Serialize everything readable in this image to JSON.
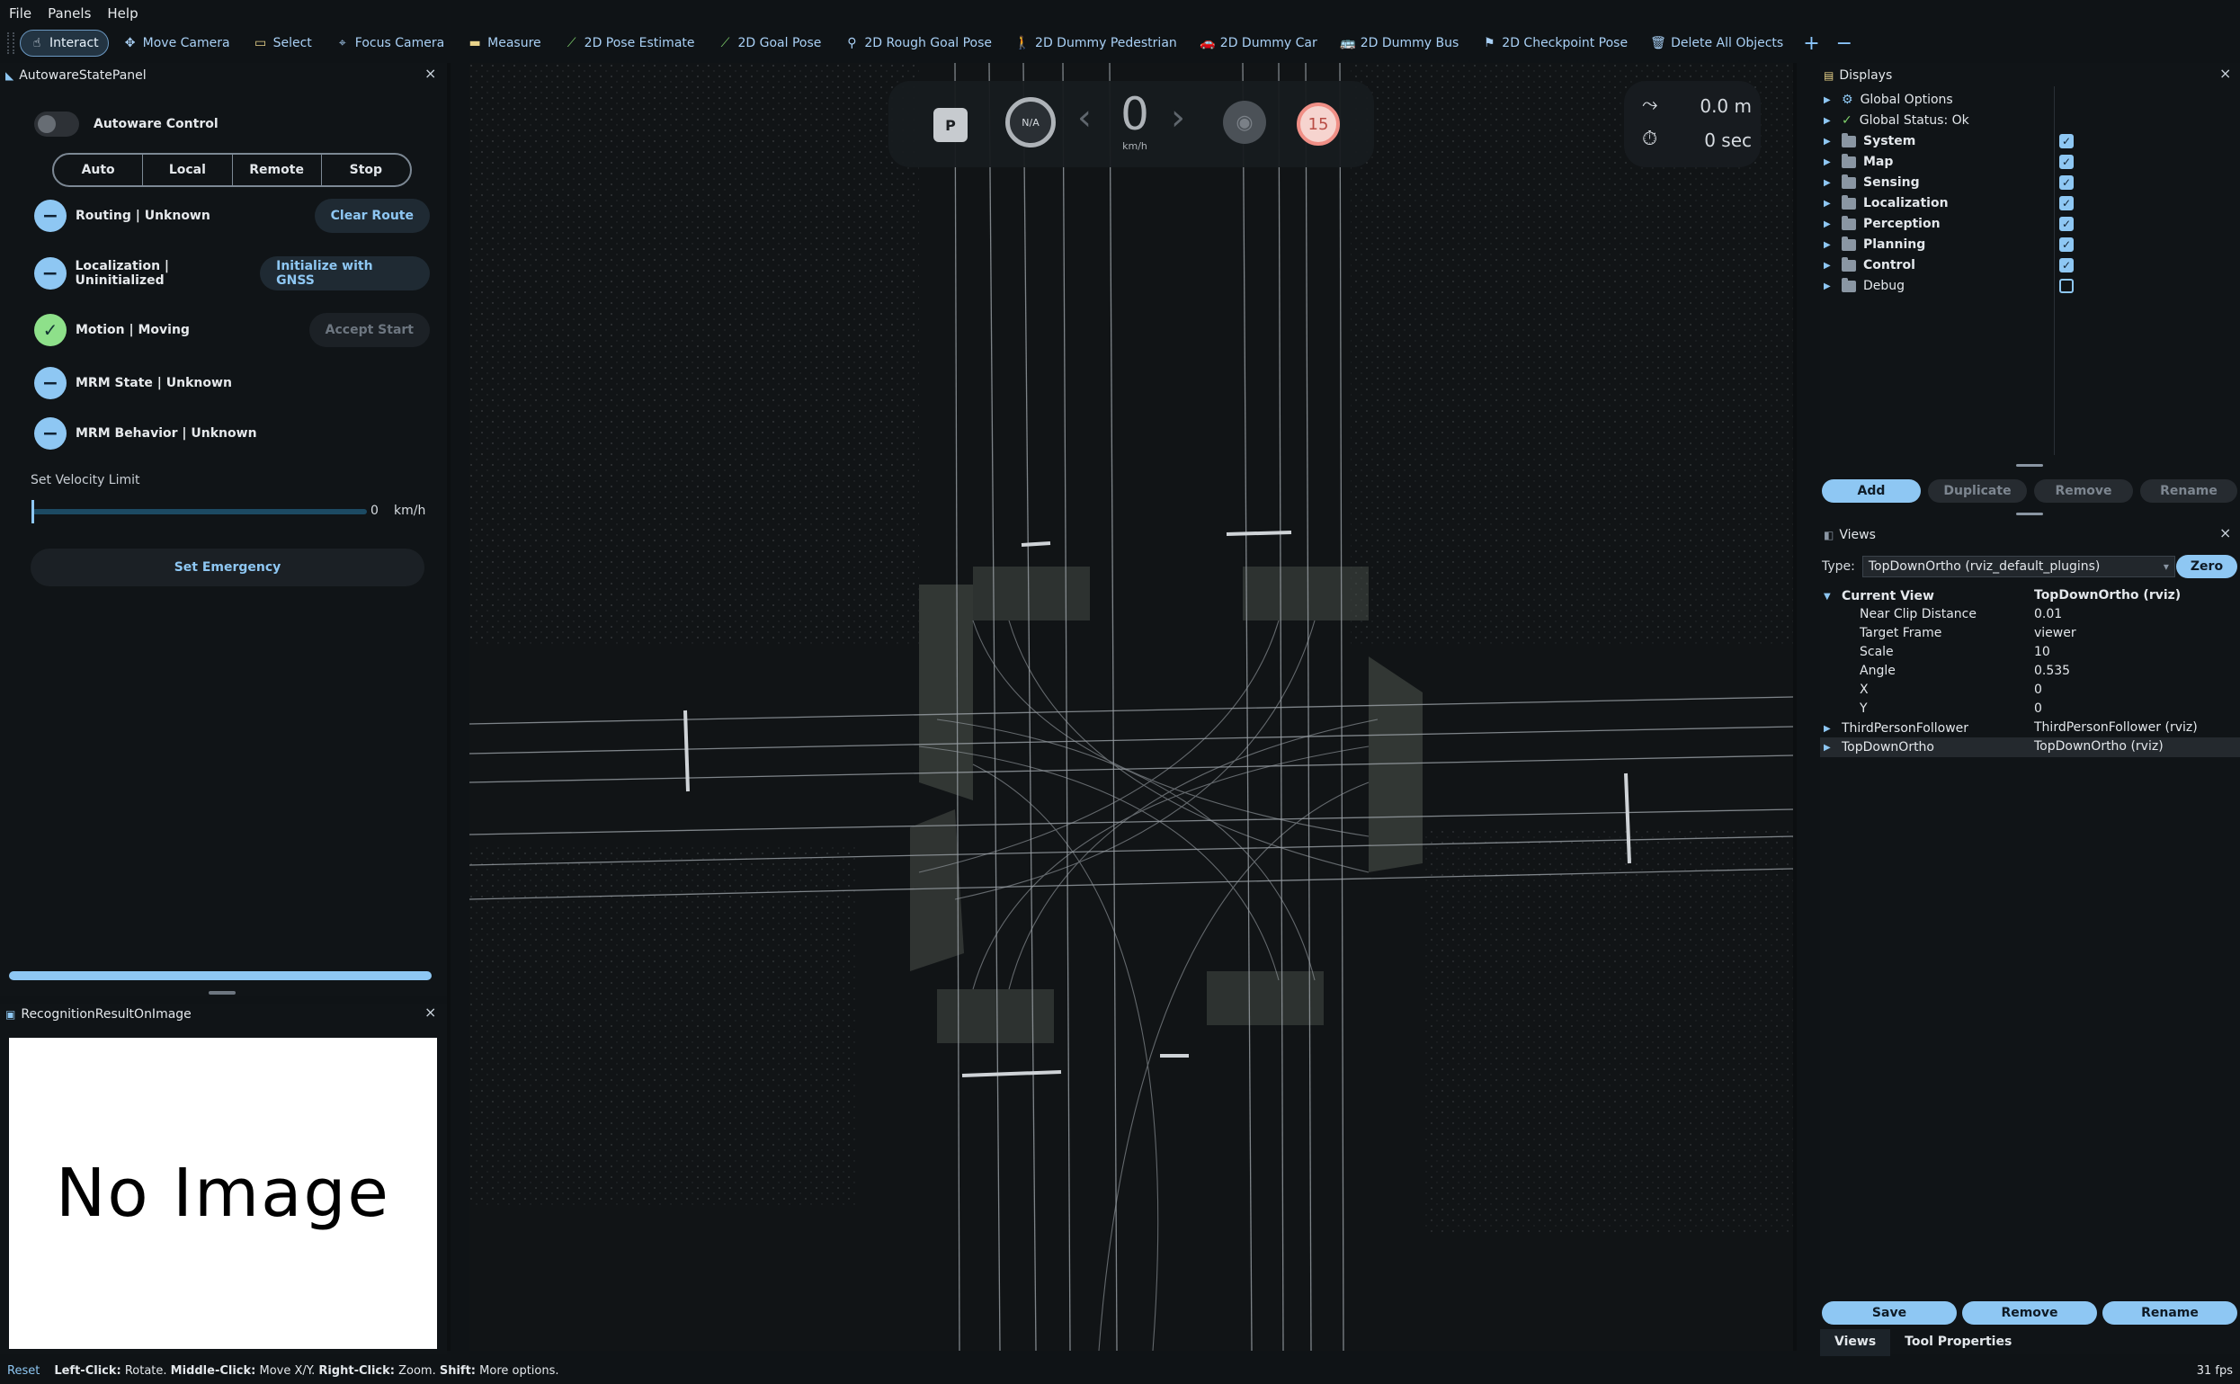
{
  "menu": [
    "File",
    "Panels",
    "Help"
  ],
  "toolbar": {
    "tools": [
      {
        "label": "Interact",
        "icon": "hand-icon"
      },
      {
        "label": "Move Camera",
        "icon": "move-icon"
      },
      {
        "label": "Select",
        "icon": "select-icon"
      },
      {
        "label": "Focus Camera",
        "icon": "crosshair-icon"
      },
      {
        "label": "Measure",
        "icon": "ruler-icon"
      },
      {
        "label": "2D Pose Estimate",
        "icon": "pose-arrow-icon"
      },
      {
        "label": "2D Goal Pose",
        "icon": "goal-arrow-icon"
      },
      {
        "label": "2D Rough Goal Pose",
        "icon": "map-pin-icon"
      },
      {
        "label": "2D Dummy Pedestrian",
        "icon": "pedestrian-icon"
      },
      {
        "label": "2D Dummy Car",
        "icon": "car-icon"
      },
      {
        "label": "2D Dummy Bus",
        "icon": "bus-icon"
      },
      {
        "label": "2D Checkpoint Pose",
        "icon": "flag-icon"
      },
      {
        "label": "Delete All Objects",
        "icon": "trash-icon"
      }
    ],
    "add": "+",
    "remove": "−"
  },
  "autoware_panel": {
    "title": "AutowareStatePanel",
    "close": "×",
    "control_label": "Autoware Control",
    "modes": [
      "Auto",
      "Local",
      "Remote",
      "Stop"
    ],
    "states": [
      {
        "label": "Routing | Unknown",
        "icon": "minus-icon",
        "button": "Clear Route",
        "button_enabled": true
      },
      {
        "label": "Localization | Uninitialized",
        "icon": "minus-icon",
        "button": "Initialize with GNSS",
        "button_enabled": true
      },
      {
        "label": "Motion | Moving",
        "icon": "check-icon",
        "button": "Accept Start",
        "button_enabled": false
      },
      {
        "label": "MRM State | Unknown",
        "icon": "minus-icon"
      },
      {
        "label": "MRM Behavior | Unknown",
        "icon": "minus-icon"
      }
    ],
    "velocity_label": "Set Velocity Limit",
    "velocity_value": "0",
    "velocity_unit": "km/h",
    "emergency": "Set Emergency"
  },
  "recognition_panel": {
    "title": "RecognitionResultOnImage",
    "close": "×",
    "placeholder": "No Image"
  },
  "hud": {
    "gear": "P",
    "steering": "N/A",
    "speed": "0",
    "speed_unit": "km/h",
    "speed_limit": "15",
    "distance": "0.0 m",
    "time": "0 sec"
  },
  "displays": {
    "title": "Displays",
    "close": "×",
    "items": [
      {
        "label": "Global Options",
        "bold": false,
        "checkbox": null
      },
      {
        "label": "Global Status: Ok",
        "bold": false,
        "checkbox": null
      },
      {
        "label": "System",
        "bold": true,
        "checkbox": true
      },
      {
        "label": "Map",
        "bold": true,
        "checkbox": true
      },
      {
        "label": "Sensing",
        "bold": true,
        "checkbox": true
      },
      {
        "label": "Localization",
        "bold": true,
        "checkbox": true
      },
      {
        "label": "Perception",
        "bold": true,
        "checkbox": true
      },
      {
        "label": "Planning",
        "bold": true,
        "checkbox": true
      },
      {
        "label": "Control",
        "bold": true,
        "checkbox": true
      },
      {
        "label": "Debug",
        "bold": false,
        "checkbox": false
      }
    ],
    "buttons": [
      "Add",
      "Duplicate",
      "Remove",
      "Rename"
    ]
  },
  "views": {
    "title": "Views",
    "close": "×",
    "type_label": "Type:",
    "type_value": "TopDownOrtho (rviz_default_plugins)",
    "zero": "Zero",
    "current_view": {
      "key": "Current View",
      "value": "TopDownOrtho (rviz)"
    },
    "properties": [
      {
        "key": "Near Clip Distance",
        "value": "0.01"
      },
      {
        "key": "Target Frame",
        "value": "viewer"
      },
      {
        "key": "Scale",
        "value": "10"
      },
      {
        "key": "Angle",
        "value": "0.535"
      },
      {
        "key": "X",
        "value": "0"
      },
      {
        "key": "Y",
        "value": "0"
      }
    ],
    "saved": [
      {
        "key": "ThirdPersonFollower",
        "value": "ThirdPersonFollower (rviz)"
      },
      {
        "key": "TopDownOrtho",
        "value": "TopDownOrtho (rviz)"
      }
    ],
    "buttons": [
      "Save",
      "Remove",
      "Rename"
    ],
    "tabs": [
      "Views",
      "Tool Properties"
    ]
  },
  "status": {
    "reset": "Reset",
    "hint_parts": [
      {
        "bold": "Left-Click:",
        "text": " Rotate. "
      },
      {
        "bold": "Middle-Click:",
        "text": " Move X/Y. "
      },
      {
        "bold": "Right-Click:",
        "text": " Zoom. "
      },
      {
        "bold": "Shift:",
        "text": " More options."
      }
    ],
    "fps": "31 fps"
  }
}
